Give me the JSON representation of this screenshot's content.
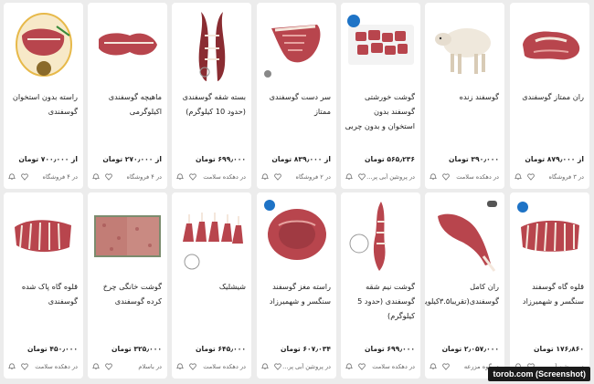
{
  "products": [
    {
      "name": "ران ممتاز گوسفندی",
      "price": "از ۸۷۹٫۰۰۰ تومان",
      "shop": "در ۳ فروشگاه",
      "img": "leg"
    },
    {
      "name": "گوسفند زنده",
      "price": "۳۹۰٫۰۰۰ تومان",
      "shop": "در دهکده سلامت",
      "img": "sheep"
    },
    {
      "name": "گوشت خورشتی گوسفند بدون استخوان و بدون چربی",
      "price": "۵۶۵٫۲۳۶ تومان",
      "shop": "در پروتئین آبی پر...",
      "img": "cubes"
    },
    {
      "name": "سر دست گوسفندی ممتاز",
      "price": "از ۸۳۹٫۰۰۰ تومان",
      "shop": "در ۲ فروشگاه",
      "img": "shoulder"
    },
    {
      "name": "بسته شقه گوسفندی (حدود 10 کیلوگرم)",
      "price": "۶۹۹٫۰۰۰ تومان",
      "shop": "در دهکده سلامت",
      "img": "carcass"
    },
    {
      "name": "ماهیچه گوسفندی اکیلوگرمی",
      "price": "از ۲۷۰٫۰۰۰ تومان",
      "shop": "در ۴ فروشگاه",
      "img": "shank"
    },
    {
      "name": "راسته بدون استخوان گوسفندی",
      "price": "از ۷۰۰٫۰۰۰ تومان",
      "shop": "در ۴ فروشگاه",
      "img": "loin"
    },
    {
      "name": "قلوه گاه گوسفند سنگسر و شهمیرزاد",
      "price": "۱۷۶٫۸۶۰ تومان",
      "shop": "در پروتئین آبی پر...",
      "img": "ribs"
    },
    {
      "name": "ران کامل گوسفندی(تقریبا۳.۵کیلویی)",
      "price": "۲٫۰۵۷٫۰۰۰ تومان",
      "shop": "در گوه مزرعه",
      "img": "fullleg"
    },
    {
      "name": "گوشت نیم شقه گوسفندی (حدود 5 کیلوگرم)",
      "price": "۶۹۹٫۰۰۰ تومان",
      "shop": "در دهکده سلامت",
      "img": "halfcarcass"
    },
    {
      "name": "راسته مغز گوسفند سنگسر و شهمیرزاد",
      "price": "۶۰۷٫۰۳۴ تومان",
      "shop": "در پروتئین آبی پر...",
      "img": "rolled"
    },
    {
      "name": "شیشلیک",
      "price": "۶۴۵٫۰۰۰ تومان",
      "shop": "در دهکده سلامت",
      "img": "rack"
    },
    {
      "name": "گوشت خانگی چرخ کرده گوسفندی",
      "price": "۳۲۵٫۰۰۰ تومان",
      "shop": "در باسلام",
      "img": "minced"
    },
    {
      "name": "قلوه گاه پاک شده گوسفندی",
      "price": "۴۵۰٫۰۰۰ تومان",
      "shop": "در دهکده سلامت",
      "img": "cleanribs"
    }
  ],
  "watermark": "torob.com (Screenshot)"
}
